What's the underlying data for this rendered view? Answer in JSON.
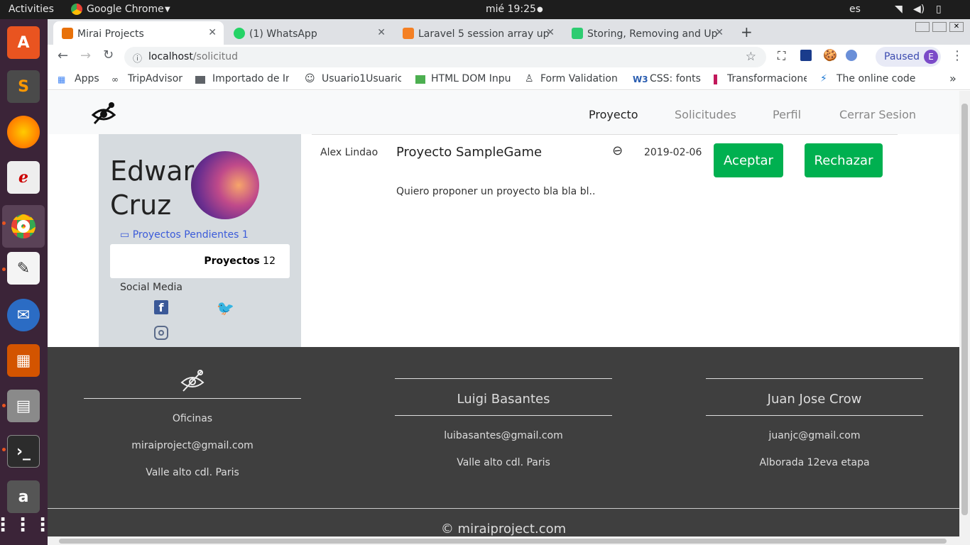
{
  "system": {
    "activities": "Activities",
    "app": "Google Chrome",
    "clock": "mié 19:25",
    "lang": "es"
  },
  "tabs": [
    {
      "title": "Mirai Projects",
      "color": "#e8710a"
    },
    {
      "title": "(1) WhatsApp",
      "color": "#25d366"
    },
    {
      "title": "Laravel 5 session array up",
      "color": "#f48024"
    },
    {
      "title": "Storing, Removing and Up",
      "color": "#2ecc71"
    }
  ],
  "address": {
    "host": "localhost",
    "path": "/solicitud",
    "paused": "Paused",
    "avatar": "E"
  },
  "bookmarks": [
    "Apps",
    "TripAdvisor",
    "Importado de In",
    "Usuario1Usuario",
    "HTML DOM Inpu",
    "Form Validation",
    "CSS: fonts",
    "Transformacione",
    "The online code"
  ],
  "nav": {
    "items": [
      "Proyecto",
      "Solicitudes",
      "Perfil",
      "Cerrar Sesion"
    ]
  },
  "profile": {
    "first": "Edward",
    "last": "Cruz",
    "pending_label": "Proyectos Pendientes",
    "pending_count": "1",
    "projects_label": "Proyectos",
    "projects_count": "12",
    "social_title": "Social Media"
  },
  "request": {
    "user": "Alex Lindao",
    "title": "Proyecto SampleGame",
    "date": "2019-02-06",
    "accept": "Aceptar",
    "reject": "Rechazar",
    "description": "Quiero proponer un proyecto bla bla bl.."
  },
  "footer": {
    "col1": {
      "label": "Oficinas",
      "email": "miraiproject@gmail.com",
      "address": "Valle alto cdl. Paris"
    },
    "col2": {
      "name": "Luigi Basantes",
      "email": "luibasantes@gmail.com",
      "address": "Valle alto cdl. Paris"
    },
    "col3": {
      "name": "Juan Jose Crow",
      "email": "juanjc@gmail.com",
      "address": "Alborada 12eva etapa"
    },
    "copyright": "© miraiproject.com"
  }
}
